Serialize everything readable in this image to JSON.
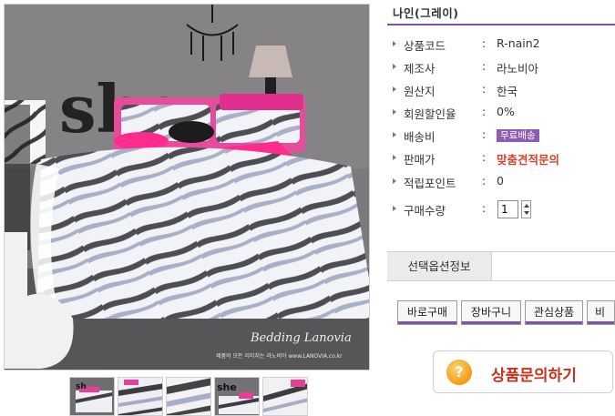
{
  "product": {
    "title": "나인(그레이)",
    "watermark_brand": "Bedding Lanovia",
    "watermark_text": "제품의 모든 이미지는 라노비아 www.LANOVIA.co.kr"
  },
  "info": [
    {
      "label": "상품코드",
      "colon": ":",
      "value": "R-nain2"
    },
    {
      "label": "제조사",
      "colon": ":",
      "value": "라노비아"
    },
    {
      "label": "원산지",
      "colon": ":",
      "value": "한국"
    },
    {
      "label": "회원할인율",
      "colon": ":",
      "value": "0%"
    },
    {
      "label": "배송비",
      "colon": ":",
      "value": "무료배송"
    },
    {
      "label": "판매가",
      "colon": ":",
      "value": "맞춤견적문의"
    },
    {
      "label": "적립포인트",
      "colon": ":",
      "value": "0"
    },
    {
      "label": "구매수량",
      "colon": ":",
      "value": "1"
    }
  ],
  "option_tab": "선택옵션정보",
  "buttons": {
    "buy_now": "바로구매",
    "cart": "장바구니",
    "wishlist": "관심상품",
    "compare": "비교"
  },
  "inquiry": {
    "label": "상품문의하기",
    "icon_text": "?"
  },
  "colors": {
    "accent": "#7f51a8",
    "price": "#d9432d",
    "badge": "#8d5cb4"
  }
}
